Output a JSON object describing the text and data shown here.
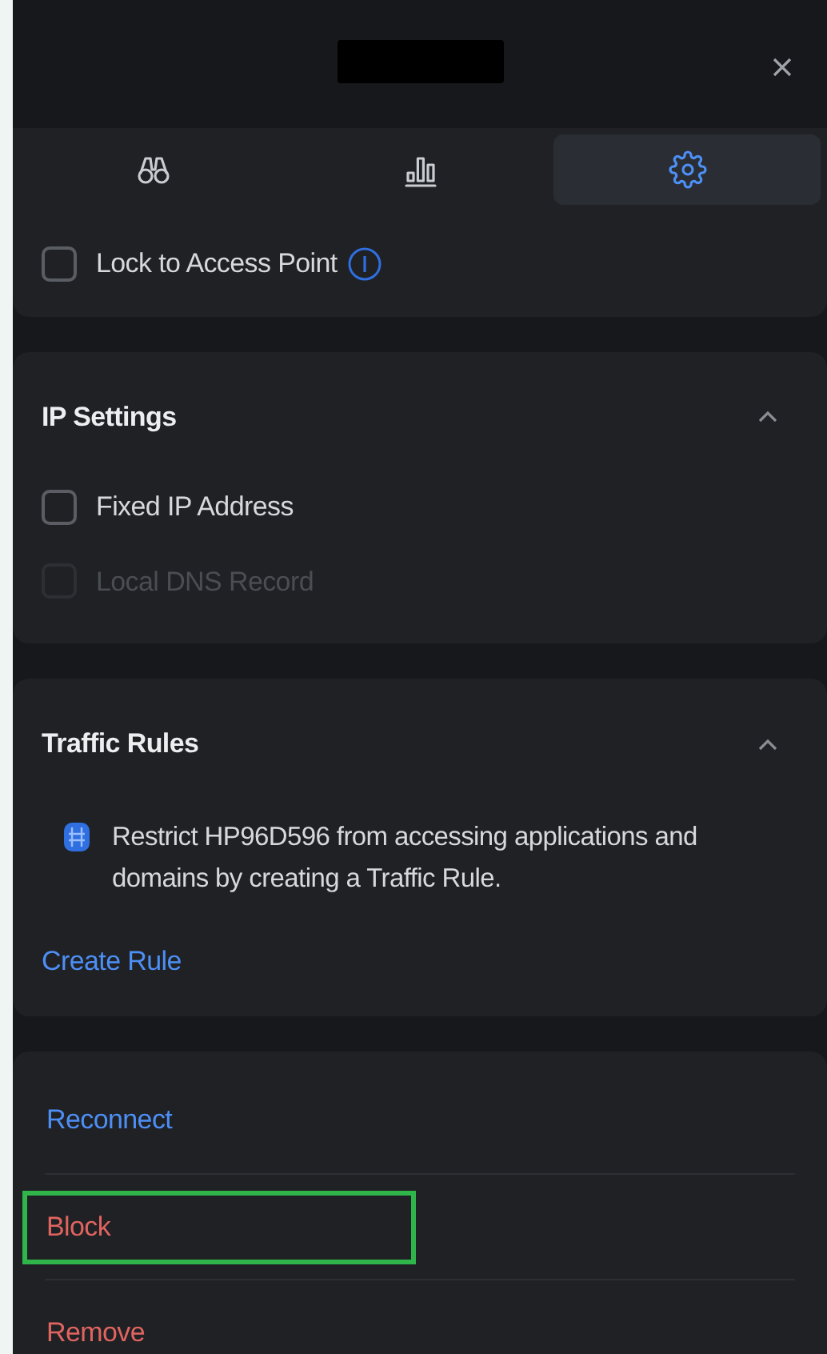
{
  "header": {
    "title_redacted": true
  },
  "tabs": [
    {
      "kind": "binoculars",
      "selected": false
    },
    {
      "kind": "chart",
      "selected": false
    },
    {
      "kind": "gear",
      "selected": true
    }
  ],
  "lock_option": {
    "label": "Lock to Access Point",
    "checked": false,
    "disabled": false
  },
  "sections": [
    {
      "title": "IP Settings",
      "expanded": true,
      "options": [
        {
          "label": "Fixed IP Address",
          "checked": false,
          "disabled": false
        },
        {
          "label": "Local DNS Record",
          "checked": false,
          "disabled": true
        }
      ]
    },
    {
      "title": "Traffic Rules",
      "expanded": true,
      "notice": "Restrict HP96D596 from accessing applications and domains by creating a Traffic Rule.",
      "link": "Create Rule"
    }
  ],
  "actions": [
    {
      "label": "Reconnect",
      "kind": "primary",
      "highlighted": false
    },
    {
      "label": "Block",
      "kind": "danger",
      "highlighted": true
    },
    {
      "label": "Remove",
      "kind": "danger",
      "highlighted": false
    }
  ]
}
